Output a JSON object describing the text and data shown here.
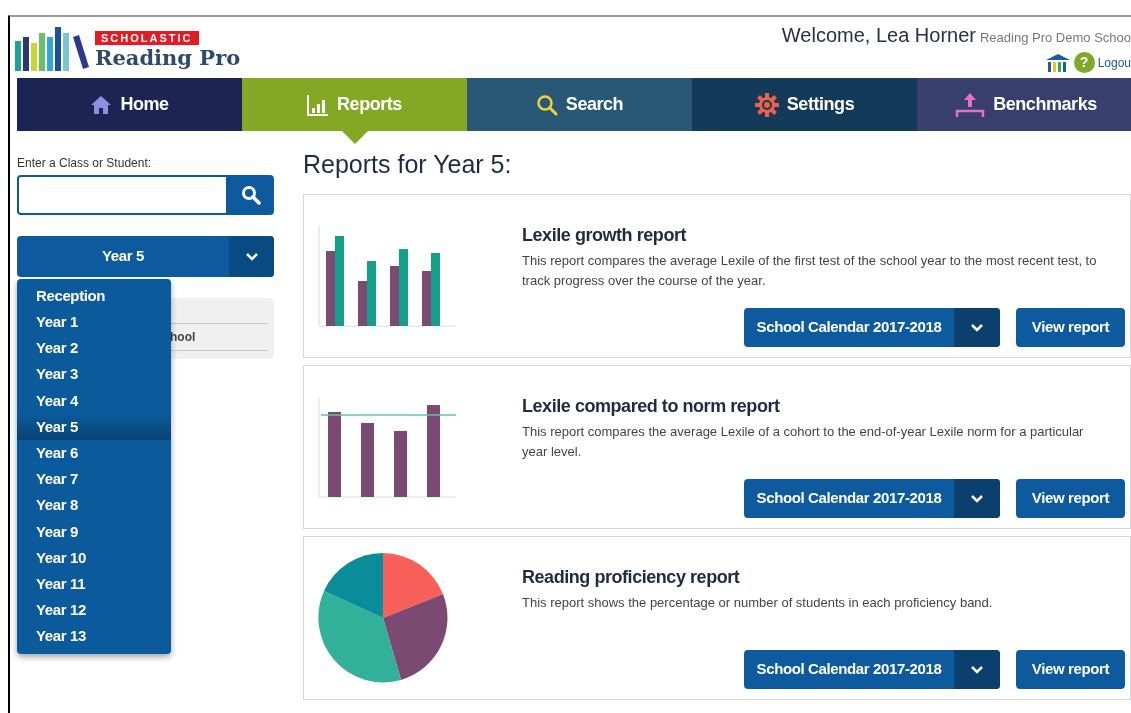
{
  "logo": {
    "brand": "SCHOLASTIC",
    "product": "Reading Pro"
  },
  "user": {
    "welcome": "Welcome, Lea Horner",
    "school": "Reading Pro Demo Schoo",
    "help": "?",
    "logout": "Logou"
  },
  "nav": [
    {
      "label": "Home",
      "selected": false,
      "color": "#1b2452"
    },
    {
      "label": "Reports",
      "selected": true,
      "color": "#85a824"
    },
    {
      "label": "Search",
      "selected": false,
      "color": "#285876"
    },
    {
      "label": "Settings",
      "selected": false,
      "color": "#133a58"
    },
    {
      "label": "Benchmarks",
      "selected": false,
      "color": "#383e6d"
    }
  ],
  "sidebar": {
    "search_label": "Enter a Class or Student:",
    "class_select": "Year 5",
    "panel_text": "hool",
    "menu": [
      {
        "label": "Reception",
        "selected": false
      },
      {
        "label": "Year 1",
        "selected": false
      },
      {
        "label": "Year 2",
        "selected": false
      },
      {
        "label": "Year 3",
        "selected": false
      },
      {
        "label": "Year 4",
        "selected": false
      },
      {
        "label": "Year 5",
        "selected": true
      },
      {
        "label": "Year 6",
        "selected": false
      },
      {
        "label": "Year 7",
        "selected": false
      },
      {
        "label": "Year 8",
        "selected": false
      },
      {
        "label": "Year 9",
        "selected": false
      },
      {
        "label": "Year 10",
        "selected": false
      },
      {
        "label": "Year 11",
        "selected": false
      },
      {
        "label": "Year 12",
        "selected": false
      },
      {
        "label": "Year 13",
        "selected": false
      }
    ]
  },
  "main": {
    "title": "Reports for Year 5:",
    "reports": [
      {
        "kind": "grouped-bars",
        "title": "Lexile growth report",
        "description": "This report compares the average Lexile of the first test of the school year to the most recent test, to track progress over the course of the year.",
        "calendar": "School Calendar 2017-2018",
        "action": "View report"
      },
      {
        "kind": "bars-with-line",
        "title": "Lexile compared to norm report",
        "description": "This report compares the average Lexile of a cohort to the end-of-year Lexile norm for a particular year level.",
        "calendar": "School Calendar 2017-2018",
        "action": "View report"
      },
      {
        "kind": "pie",
        "title": "Reading proficiency report",
        "description": "This report shows the percentage or number of students in each proficiency band.",
        "calendar": "School Calendar 2017-2018",
        "action": "View report"
      }
    ]
  }
}
